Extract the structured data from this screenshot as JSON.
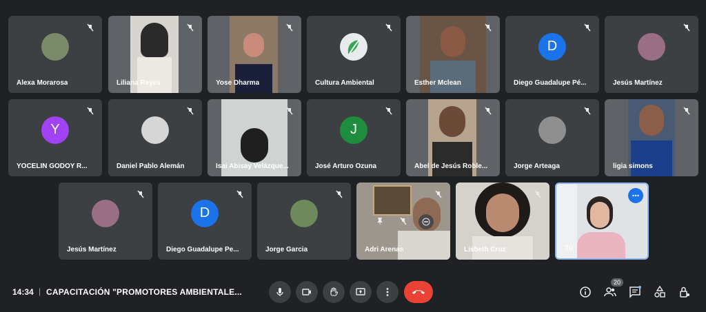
{
  "participants_row1": [
    {
      "name": "Alexa Morarosa"
    },
    {
      "name": "Liliana Reyes"
    },
    {
      "name": "Yose Dharma"
    },
    {
      "name": "Cultura Ambiental"
    },
    {
      "name": "Esther Mclean"
    },
    {
      "name": "Diego Guadalupe Pé...",
      "initial": "D"
    },
    {
      "name": "Jesús Martínez"
    }
  ],
  "participants_row2": [
    {
      "name": "YOCELIN GODOY R...",
      "initial": "Y"
    },
    {
      "name": "Daniel Pablo Alemán"
    },
    {
      "name": "Isai Abisay Velázque..."
    },
    {
      "name": "José Arturo Ozuna",
      "initial": "J"
    },
    {
      "name": "Abel de Jesús Roble..."
    },
    {
      "name": "Jorge Arteaga"
    },
    {
      "name": "ligia simons"
    }
  ],
  "participants_row3": [
    {
      "name": "Jesús Martínez"
    },
    {
      "name": "Diego Guadalupe Pe...",
      "initial": "D"
    },
    {
      "name": "Jorge Garcia"
    },
    {
      "name": "Adri Arenas"
    },
    {
      "name": "Lisbeth Cruz"
    },
    {
      "name": "Tú"
    }
  ],
  "bottom_bar": {
    "time": "14:34",
    "separator": "|",
    "meeting_title": "CAPACITACIÓN \"PROMOTORES AMBIENTALE...",
    "participant_count": "20"
  },
  "colors": {
    "background": "#202124",
    "tile": "#3c4043",
    "end_call": "#ea4335",
    "avatar_blue": "#1a73e8",
    "avatar_purple": "#a142f4",
    "avatar_green": "#1e8e3e",
    "self_border": "#8ab4f8"
  }
}
